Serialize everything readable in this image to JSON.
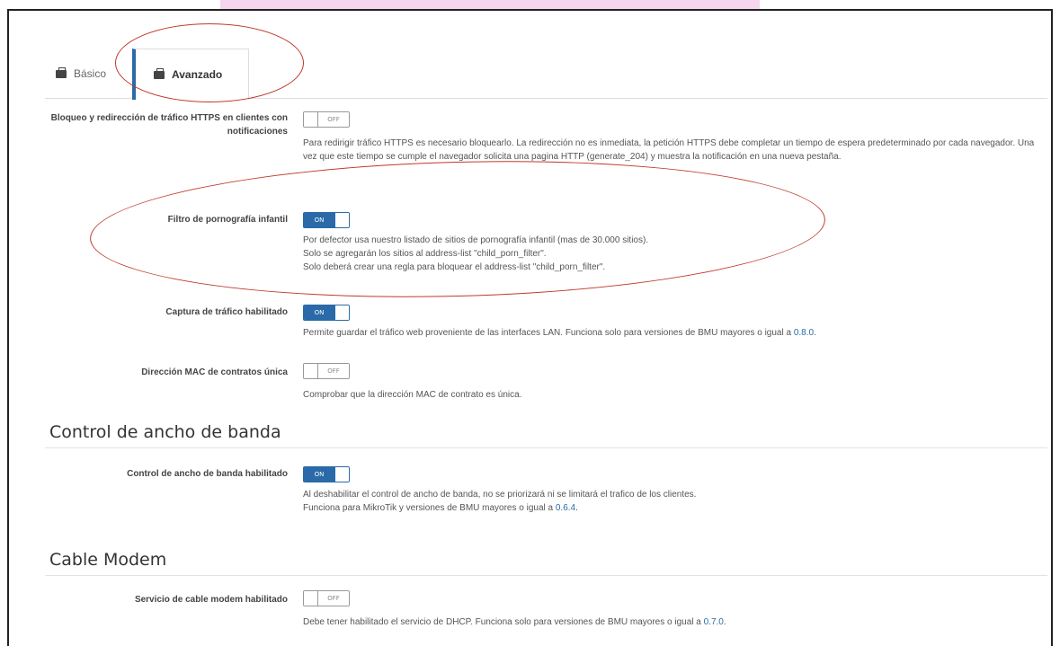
{
  "tabs": [
    {
      "label": "Básico",
      "active": false
    },
    {
      "label": "Avanzado",
      "active": true
    }
  ],
  "settings": [
    {
      "label": "Bloqueo y redirección de tráfico HTTPS en clientes con notificaciones",
      "toggle": "OFF",
      "desc": "Para redirigir tráfico HTTPS es necesario bloquearlo. La redirección no es inmediata, la petición HTTPS debe completar un tiempo de espera predeterminado por cada navegador. Una vez que este tiempo se cumple el navegador solicita una pagina HTTP (generate_204) y muestra la notificación en una nueva pestaña."
    },
    {
      "label": "Filtro de pornografía infantil",
      "toggle": "ON",
      "desc_lines": [
        "Por defector usa nuestro listado de sitios de pornografía infantil (mas de 30.000 sitios).",
        "Solo se agregarán los sitios al address-list \"child_porn_filter\".",
        "Solo deberá crear una regla para bloquear el address-list \"child_porn_filter\"."
      ]
    },
    {
      "label": "Captura de tráfico habilitado",
      "toggle": "ON",
      "desc": "Permite guardar el tráfico web proveniente de las interfaces LAN. Funciona solo para versiones de BMU mayores o igual a",
      "version": "0.8.0",
      "suffix": "."
    },
    {
      "label": "Dirección MAC de contratos única",
      "toggle": "OFF",
      "desc": "Comprobar que la dirección MAC de contrato es única."
    }
  ],
  "bandwidth": {
    "title": "Control de ancho de banda",
    "label": "Control de ancho de banda habilitado",
    "toggle": "ON",
    "line1": "Al deshabilitar el control de ancho de banda, no se priorizará ni se limitará el trafico de los clientes.",
    "line2": "Funciona para MikroTik y versiones de BMU mayores o igual a",
    "version": "0.6.4",
    "suffix": "."
  },
  "cable": {
    "title": "Cable Modem",
    "label": "Servicio de cable modem habilitado",
    "toggle": "OFF",
    "desc": "Debe tener habilitado el servicio de DHCP. Funciona solo para versiones de BMU mayores o igual a",
    "version": "0.7.0",
    "suffix": "."
  },
  "colors": {
    "accent": "#2a6aa8",
    "annotation": "#c0392b"
  },
  "icons": {
    "tab": "briefcase-icon"
  }
}
